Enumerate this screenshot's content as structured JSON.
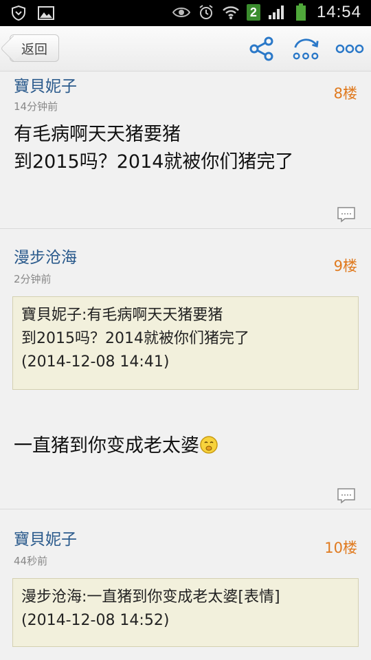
{
  "status_bar": {
    "time": "14:54",
    "sim_badge": "2",
    "icons": [
      "shield-icon",
      "image-icon",
      "eye-icon",
      "alarm-icon",
      "wifi-icon",
      "signal-icon",
      "battery-icon"
    ]
  },
  "navbar": {
    "back_label": "返回",
    "icons": [
      "share-icon",
      "reply-arrow-icon",
      "more-icon"
    ],
    "accent_color": "#2a78c8"
  },
  "posts": [
    {
      "author": "寶貝妮子",
      "time": "14分钟前",
      "floor": "8楼",
      "content_lines": [
        "有毛病啊天天猪要猪",
        "到2015吗？2014就被你们猪完了"
      ]
    },
    {
      "author": "漫步沧海",
      "time": "2分钟前",
      "floor": "9楼",
      "quote_lines": [
        "寶貝妮子:有毛病啊天天猪要猪",
        "到2015吗？2014就被你们猪完了",
        "(2014-12-08 14:41)"
      ],
      "content": "一直猪到你变成老太婆"
    },
    {
      "author": "寶貝妮子",
      "time": "44秒前",
      "floor": "10楼",
      "quote_lines": [
        "漫步沧海:一直猪到你变成老太婆[表情]",
        "(2014-12-08 14:52)"
      ]
    }
  ]
}
